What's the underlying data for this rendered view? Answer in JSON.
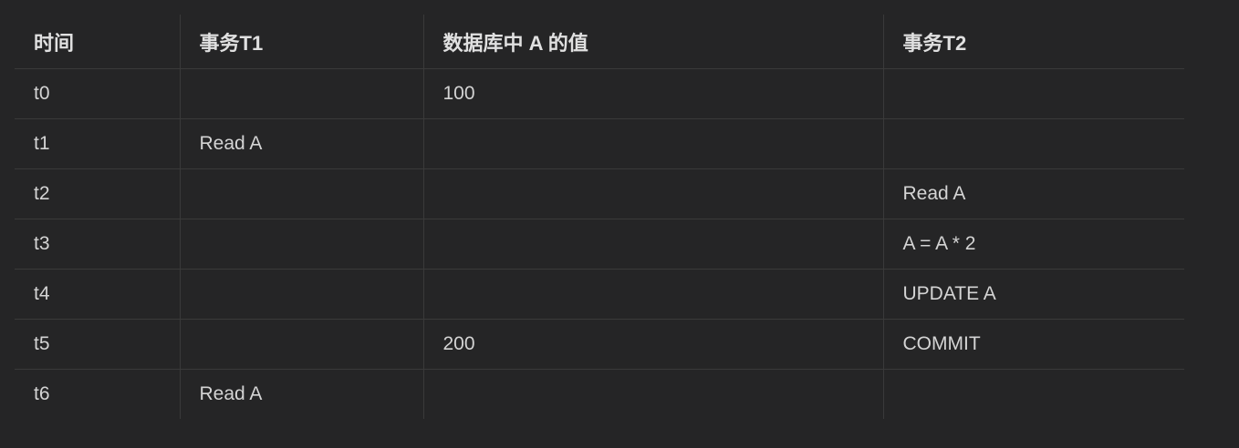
{
  "table": {
    "headers": [
      "时间",
      "事务T1",
      "数据库中 A 的值",
      "事务T2"
    ],
    "rows": [
      {
        "time": "t0",
        "t1": "",
        "db": "100",
        "t2": ""
      },
      {
        "time": "t1",
        "t1": "Read A",
        "db": "",
        "t2": ""
      },
      {
        "time": "t2",
        "t1": "",
        "db": "",
        "t2": "Read A"
      },
      {
        "time": "t3",
        "t1": "",
        "db": "",
        "t2": "A = A * 2"
      },
      {
        "time": "t4",
        "t1": "",
        "db": "",
        "t2": "UPDATE A"
      },
      {
        "time": "t5",
        "t1": "",
        "db": "200",
        "t2": "COMMIT"
      },
      {
        "time": "t6",
        "t1": "Read A",
        "db": "",
        "t2": ""
      }
    ]
  }
}
